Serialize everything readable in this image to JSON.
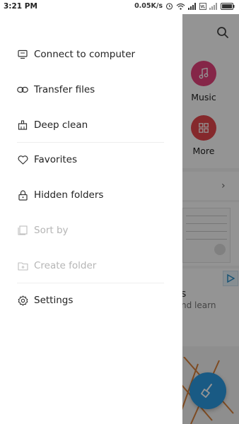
{
  "status_bar": {
    "time": "3:21 PM",
    "net_speed": "0.05K/s",
    "icons": [
      "alarm-icon",
      "wifi-icon",
      "signal-icon",
      "volte-icon",
      "signal-icon",
      "battery-icon"
    ]
  },
  "drawer": {
    "items": [
      {
        "label": "Connect to computer",
        "icon": "monitor-icon",
        "enabled": true
      },
      {
        "label": "Transfer files",
        "icon": "link-icon",
        "enabled": true
      },
      {
        "label": "Deep clean",
        "icon": "broom-icon",
        "enabled": true
      },
      {
        "label": "Favorites",
        "icon": "heart-icon",
        "enabled": true
      },
      {
        "label": "Hidden folders",
        "icon": "lock-icon",
        "enabled": true
      },
      {
        "label": "Sort by",
        "icon": "sort-icon",
        "enabled": false
      },
      {
        "label": "Create folder",
        "icon": "folder-plus-icon",
        "enabled": false
      },
      {
        "label": "Settings",
        "icon": "gear-icon",
        "enabled": true
      }
    ]
  },
  "background": {
    "tiles": [
      {
        "label": "Music",
        "icon": "music-note-icon",
        "color": "#e6427c"
      },
      {
        "label": "More",
        "icon": "grid-icon",
        "color": "#e5484d"
      }
    ],
    "ad_text": "nd learn",
    "ad_text_heading": "s"
  },
  "colors": {
    "accent": "#2c9be3",
    "scrim": "rgba(0,0,0,0.42)"
  }
}
